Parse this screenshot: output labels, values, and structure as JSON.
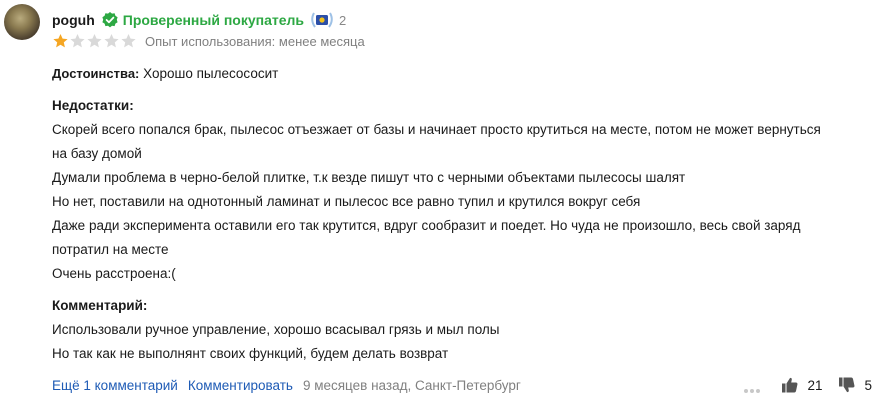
{
  "author": {
    "name": "poguh"
  },
  "verified": {
    "label": "Проверенный покупатель",
    "color": "#2da843"
  },
  "badge": {
    "count": "2",
    "icon": "laurel-badge-icon"
  },
  "rating": {
    "value": 1,
    "max": 5,
    "filled_color": "#f5a623",
    "empty_color": "#d9d9d9"
  },
  "experience": "Опыт использования: менее месяца",
  "pros": {
    "label": "Достоинства:",
    "text": "Хорошо пылесососит"
  },
  "cons": {
    "label": "Недостатки:",
    "lines": [
      "Скорей всего попался брак, пылесос отъезжает от базы и начинает просто крутиться на месте, потом не может вернуться",
      "на базу домой",
      "Думали проблема в черно-белой плитке, т.к везде пишут что с черными объектами пылесосы шалят",
      "Но нет, поставили на однотонный ламинат и пылесос все равно тупил и крутился вокруг себя",
      "Даже ради эксперимента оставили его так крутится, вдруг сообразит и поедет. Но чуда не произошло, весь свой заряд",
      "потратил на месте",
      "Очень расстроена:("
    ]
  },
  "comment": {
    "label": "Комментарий:",
    "lines": [
      "Использовали ручное управление, хорошо всасывал грязь и мыл полы",
      "Но так как не выполнянт своих функций, будем делать возврат"
    ]
  },
  "footer": {
    "more_comments": "Ещё 1 комментарий",
    "reply": "Комментировать",
    "meta": "9 месяцев назад, Санкт-Петербург",
    "link_color": "#1e5bb5"
  },
  "votes": {
    "likes": "21",
    "dislikes": "5"
  }
}
